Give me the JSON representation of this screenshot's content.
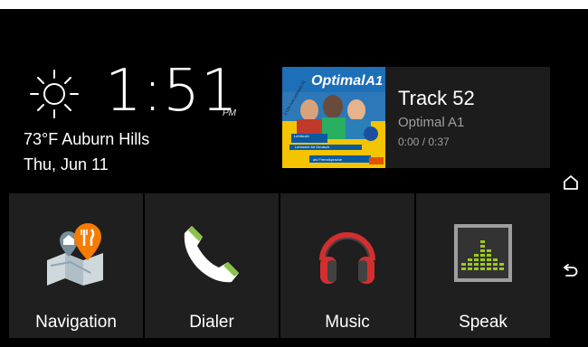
{
  "status_strip": {
    "color": "#ffffff"
  },
  "clock": {
    "time": "1:51",
    "ampm": "PM",
    "weather_icon": "sun-icon",
    "temperature": "73°F",
    "location": "Auburn Hills",
    "weather_line": "73°F Auburn Hills",
    "date": "Thu, Jun 11"
  },
  "media": {
    "album_art": {
      "title_text": "Optimal",
      "badge_text": "A1",
      "sticker_text": "2 CDs zum Lehrbuch A1",
      "caption_text": "Lehrbuch",
      "subtitle_line1": "Lehrwerk für Deutsch",
      "subtitle_line2": "als Fremdsprache"
    },
    "track_title": "Track 52",
    "album": "Optimal A1",
    "progress": "0:00 / 0:37"
  },
  "tiles": [
    {
      "label": "Navigation",
      "icon": "navigation-map-icon"
    },
    {
      "label": "Dialer",
      "icon": "phone-icon"
    },
    {
      "label": "Music",
      "icon": "headphones-icon"
    },
    {
      "label": "Speak",
      "icon": "equalizer-icon"
    }
  ],
  "side_nav": [
    {
      "icon": "home-icon"
    },
    {
      "icon": "back-icon"
    }
  ],
  "colors": {
    "background": "#000000",
    "tile": "#1f1f1f",
    "card": "#1c1c1c",
    "secondary_text": "#9e9e9e",
    "phone_green": "#8bc34a",
    "headphones_red": "#d32f2f",
    "equalizer_green": "#9ccc1a"
  }
}
